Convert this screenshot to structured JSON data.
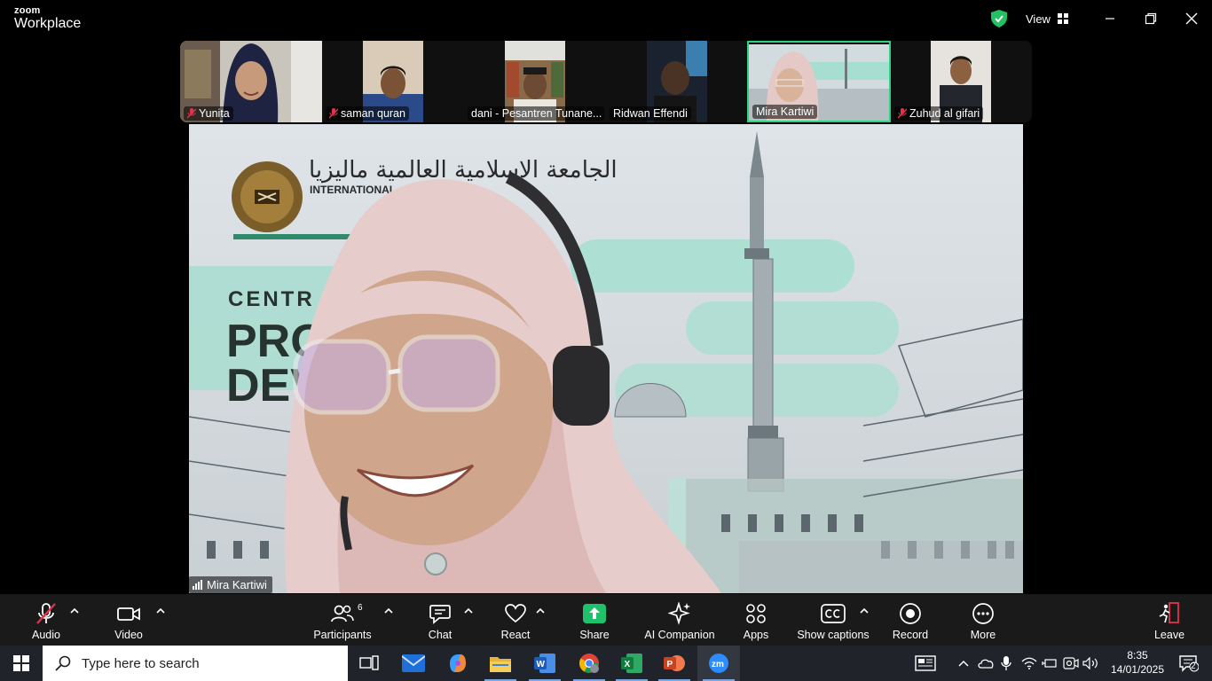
{
  "window": {
    "brand_small": "zoom",
    "brand_big": "Workplace",
    "view_label": "View"
  },
  "thumbnails": [
    {
      "name": "Yunita",
      "muted": true
    },
    {
      "name": "saman quran",
      "muted": true
    },
    {
      "name": "dani - Pesantren Tunane...",
      "muted": false
    },
    {
      "name": "Ridwan Effendi",
      "muted": false
    },
    {
      "name": "Mira Kartiwi",
      "muted": false,
      "active": true
    },
    {
      "name": "Zuhud al gifari",
      "muted": true
    }
  ],
  "main_video": {
    "speaker_name": "Mira Kartiwi",
    "background_text": {
      "arabic": "الجامعة الإسلامية العالمية ماليزيا",
      "english": "INTERNATIONAL",
      "line1": "CENTR",
      "line2": "PRO",
      "line3": "DEV"
    }
  },
  "toolbar": {
    "audio": "Audio",
    "video": "Video",
    "participants": "Participants",
    "participants_count": "6",
    "chat": "Chat",
    "react": "React",
    "share": "Share",
    "ai_companion": "AI Companion",
    "apps": "Apps",
    "show_captions": "Show captions",
    "record": "Record",
    "more": "More",
    "leave": "Leave"
  },
  "taskbar": {
    "search_placeholder": "Type here to search",
    "time": "8:35",
    "date": "14/01/2025",
    "notification_count": "2"
  },
  "colors": {
    "accent_green": "#2bd47e",
    "share_green": "#1fc16b",
    "mute_red": "#e0334a",
    "toolbar_bg": "#1a1a1a",
    "taskbar_bg": "#20232a"
  }
}
